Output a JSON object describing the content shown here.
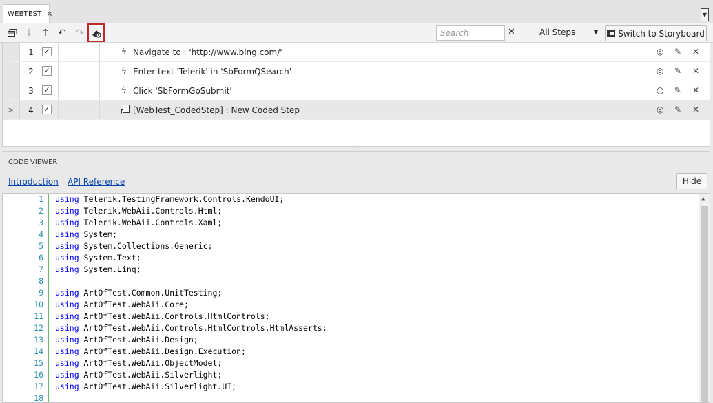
{
  "tab": {
    "title": "WEBTEST",
    "close": "✕"
  },
  "toolbar": {
    "search_placeholder": "Search",
    "search_clear": "✕",
    "filter_value": "All Steps",
    "switch_label": "Switch to Storyboard"
  },
  "steps": [
    {
      "num": "1",
      "checked": "✓",
      "desc": "Navigate to : 'http://www.bing.com/'"
    },
    {
      "num": "2",
      "checked": "✓",
      "desc": "Enter text 'Telerik' in 'SbFormQSearch'"
    },
    {
      "num": "3",
      "checked": "✓",
      "desc": "Click 'SbFormGoSubmit'"
    },
    {
      "num": "4",
      "checked": "✓",
      "desc": "[WebTest_CodedStep] : New Coded Step",
      "selected_marker": ">"
    }
  ],
  "code_viewer": {
    "title": "CODE VIEWER",
    "links": [
      "Introduction",
      "API Reference"
    ],
    "hide_label": "Hide",
    "keyword": "using",
    "lines": [
      {
        "n": "1",
        "text": "Telerik.TestingFramework.Controls.KendoUI;"
      },
      {
        "n": "2",
        "text": "Telerik.WebAii.Controls.Html;"
      },
      {
        "n": "3",
        "text": "Telerik.WebAii.Controls.Xaml;"
      },
      {
        "n": "4",
        "text": "System;"
      },
      {
        "n": "5",
        "text": "System.Collections.Generic;"
      },
      {
        "n": "6",
        "text": "System.Text;"
      },
      {
        "n": "7",
        "text": "System.Linq;"
      },
      {
        "n": "8",
        "text": ""
      },
      {
        "n": "9",
        "text": "ArtOfTest.Common.UnitTesting;"
      },
      {
        "n": "10",
        "text": "ArtOfTest.WebAii.Core;"
      },
      {
        "n": "11",
        "text": "ArtOfTest.WebAii.Controls.HtmlControls;"
      },
      {
        "n": "12",
        "text": "ArtOfTest.WebAii.Controls.HtmlControls.HtmlAsserts;"
      },
      {
        "n": "13",
        "text": "ArtOfTest.WebAii.Design;"
      },
      {
        "n": "14",
        "text": "ArtOfTest.WebAii.Design.Execution;"
      },
      {
        "n": "15",
        "text": "ArtOfTest.WebAii.ObjectModel;"
      },
      {
        "n": "16",
        "text": "ArtOfTest.WebAii.Silverlight;"
      },
      {
        "n": "17",
        "text": "ArtOfTest.WebAii.Silverlight.UI;"
      },
      {
        "n": "18",
        "text": ""
      }
    ]
  },
  "colors": {
    "highlight_border": "#c0272d",
    "keyword": "#0000ff",
    "line_number": "#2b91af",
    "link": "#0645ad"
  }
}
